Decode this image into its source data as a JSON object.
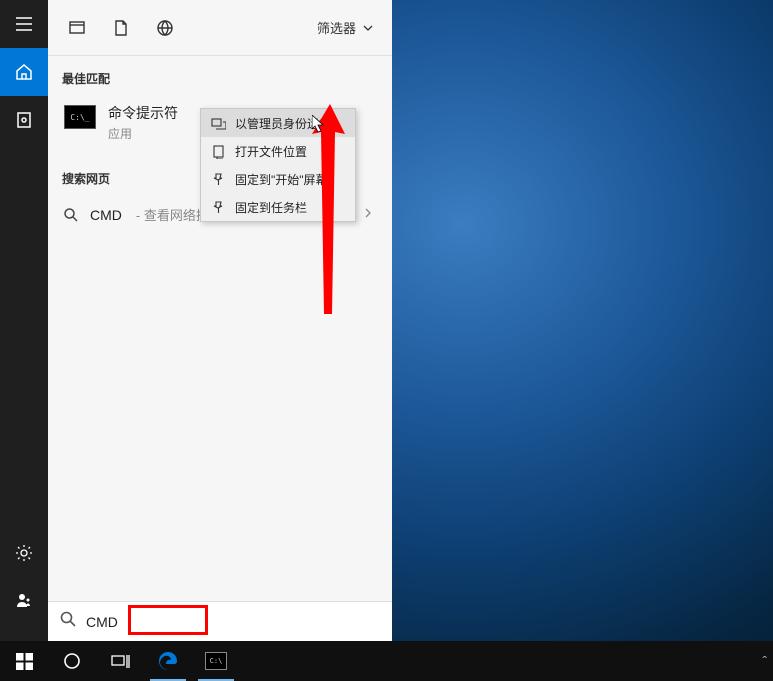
{
  "panel": {
    "filter_label": "筛选器",
    "best_match_title": "最佳匹配",
    "result": {
      "title": "命令提示符",
      "subtitle": "应用",
      "icon_text": "C:\\_"
    },
    "web_section_title": "搜索网页",
    "web_query": "CMD",
    "web_hint": "- 查看网络搜",
    "search_value": "CMD"
  },
  "context_menu": {
    "items": [
      {
        "label": "以管理员身份运行",
        "icon": "admin"
      },
      {
        "label": "打开文件位置",
        "icon": "folder"
      },
      {
        "label": "固定到\"开始\"屏幕",
        "icon": "pin-start"
      },
      {
        "label": "固定到任务栏",
        "icon": "pin-taskbar"
      }
    ]
  }
}
